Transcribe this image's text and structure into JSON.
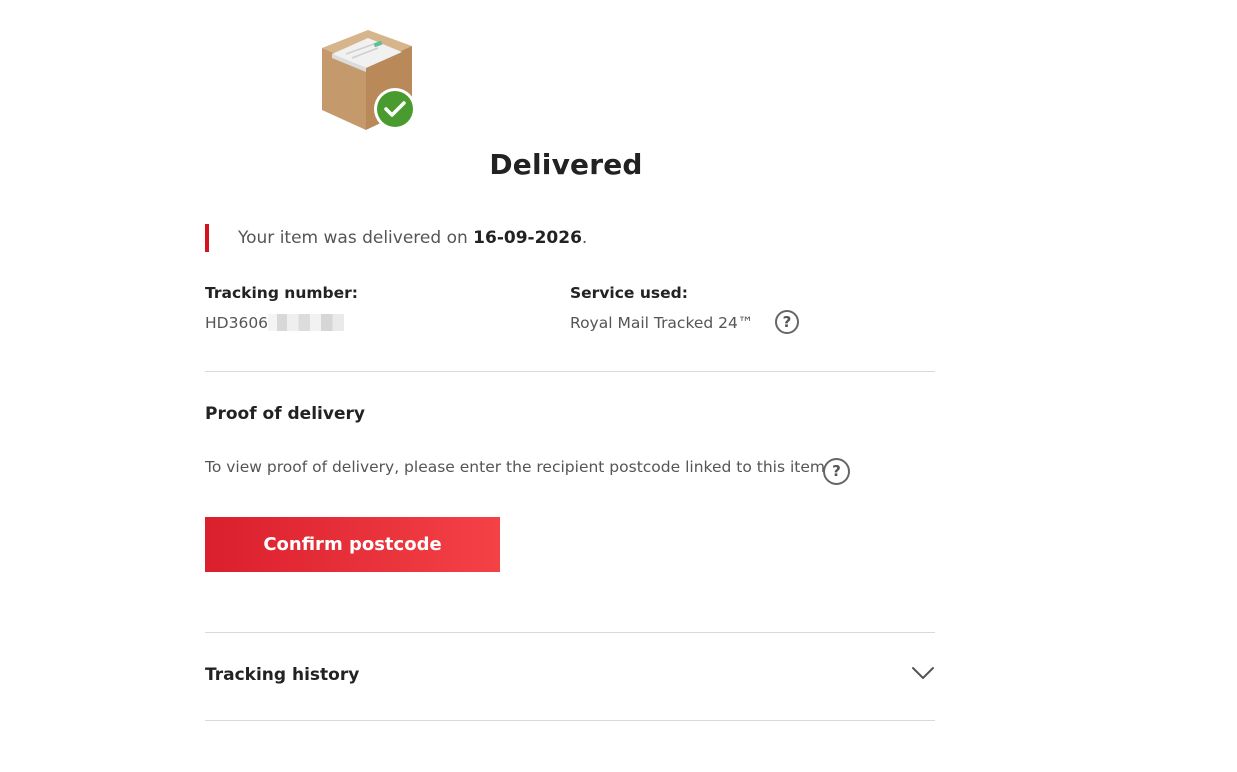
{
  "status": {
    "title": "Delivered",
    "icon": "parcel-delivered-icon",
    "check_color": "#4a9b2f"
  },
  "notice": {
    "prefix": "Your item was delivered on ",
    "date": "16-09-2026",
    "suffix": ".",
    "accent_color": "#d6121f"
  },
  "tracking": {
    "label": "Tracking number:",
    "value_visible": "HD3606"
  },
  "service": {
    "label": "Service used:",
    "value": "Royal Mail Tracked 24™",
    "help_glyph": "?"
  },
  "proof": {
    "title": "Proof of delivery",
    "text": "To view proof of delivery, please enter the recipient postcode linked to this item",
    "help_glyph": "?",
    "button_label": "Confirm postcode",
    "button_color": "#e32b35"
  },
  "history": {
    "title": "Tracking history",
    "expand_icon": "chevron-down-icon"
  }
}
